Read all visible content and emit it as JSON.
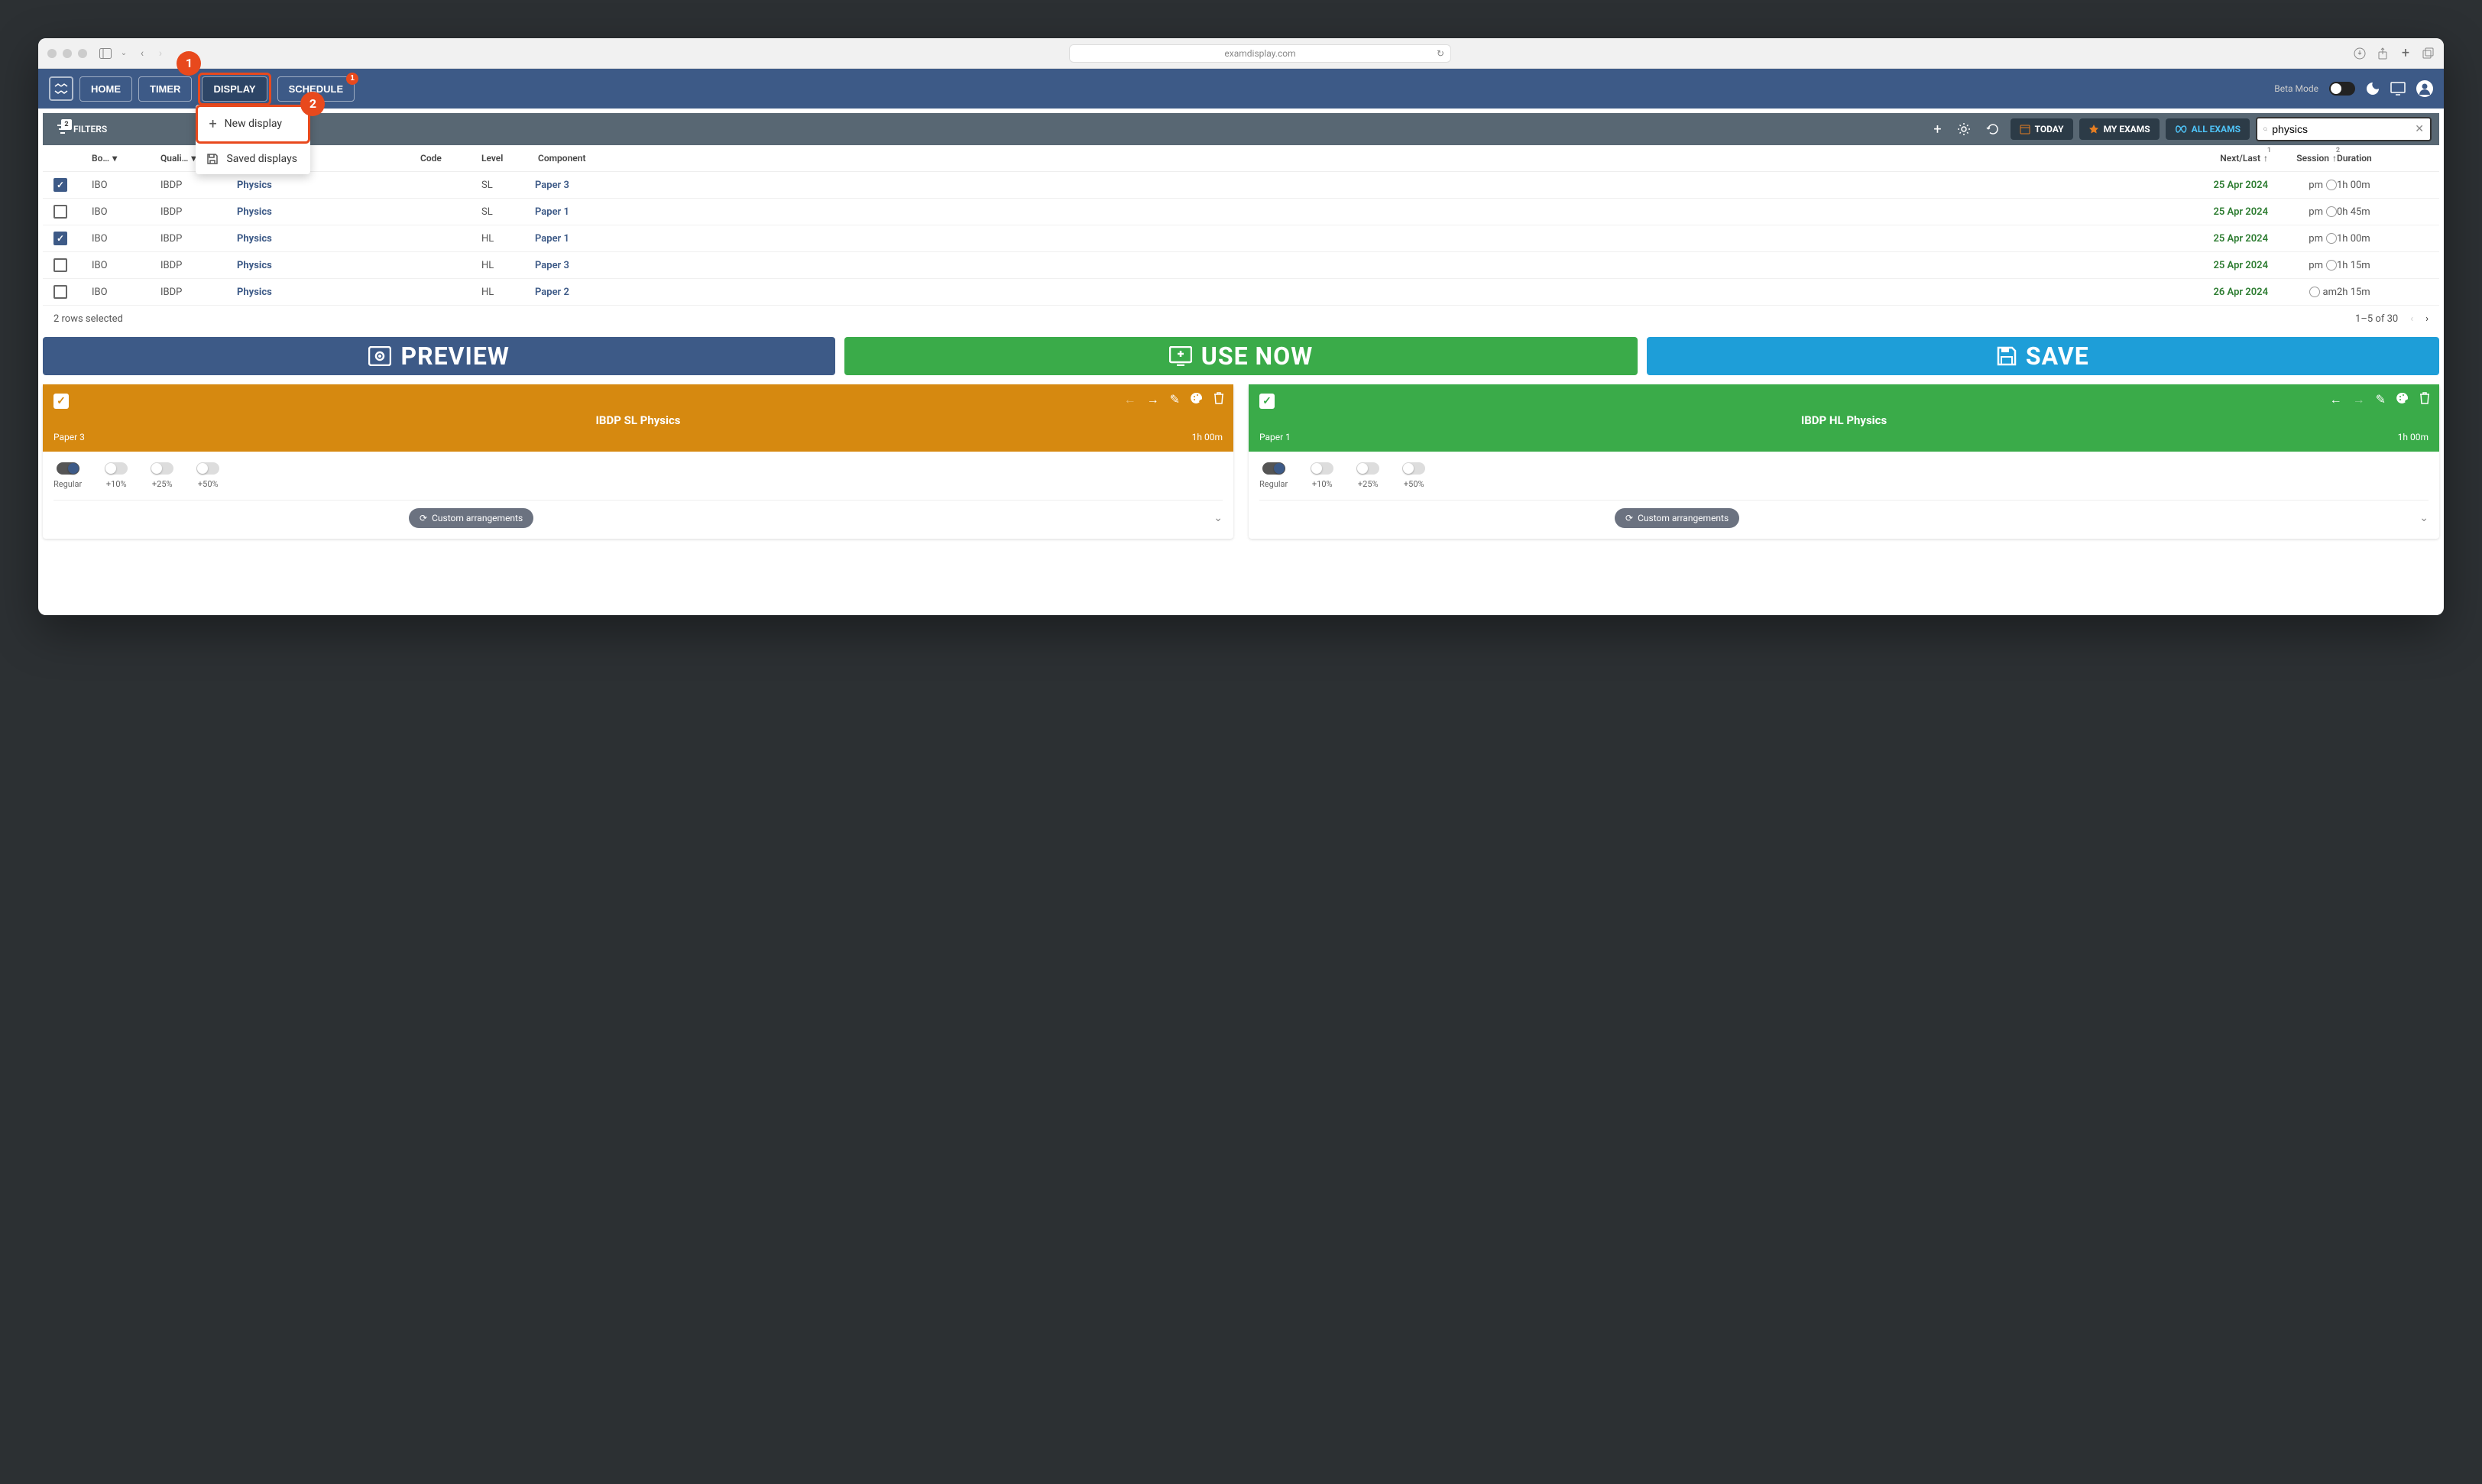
{
  "browser": {
    "url": "examdisplay.com"
  },
  "nav": {
    "home": "HOME",
    "timer": "TIMER",
    "display": "DISPLAY",
    "schedule": "SCHEDULE",
    "schedule_badge": "1"
  },
  "callouts": {
    "one": "1",
    "two": "2"
  },
  "dropdown": {
    "new": "New display",
    "saved": "Saved displays"
  },
  "header_right": {
    "beta": "Beta Mode"
  },
  "filters": {
    "label": "FILTERS",
    "badge": "2",
    "today": "TODAY",
    "myexams": "MY EXAMS",
    "allexams": "ALL EXAMS",
    "search_value": "physics"
  },
  "table": {
    "headers": {
      "board": "Bo…",
      "qualif": "Quali…",
      "code": "Code",
      "level": "Level",
      "component": "Component",
      "nextlast": "Next/Last",
      "session": "Session",
      "duration": "Duration",
      "sort_nextlast": "1",
      "sort_session": "2"
    },
    "rows": [
      {
        "checked": true,
        "board": "IBO",
        "qual": "IBDP",
        "subject": "Physics",
        "code": "",
        "level": "SL",
        "component": "Paper 3",
        "date": "25 Apr 2024",
        "sessText": "pm",
        "sessAfter": "clock",
        "duration": "1h 00m"
      },
      {
        "checked": false,
        "board": "IBO",
        "qual": "IBDP",
        "subject": "Physics",
        "code": "",
        "level": "SL",
        "component": "Paper 1",
        "date": "25 Apr 2024",
        "sessText": "pm",
        "sessAfter": "clock",
        "duration": "0h 45m"
      },
      {
        "checked": true,
        "board": "IBO",
        "qual": "IBDP",
        "subject": "Physics",
        "code": "",
        "level": "HL",
        "component": "Paper 1",
        "date": "25 Apr 2024",
        "sessText": "pm",
        "sessAfter": "clock",
        "duration": "1h 00m"
      },
      {
        "checked": false,
        "board": "IBO",
        "qual": "IBDP",
        "subject": "Physics",
        "code": "",
        "level": "HL",
        "component": "Paper 3",
        "date": "25 Apr 2024",
        "sessText": "pm",
        "sessAfter": "clock",
        "duration": "1h 15m"
      },
      {
        "checked": false,
        "board": "IBO",
        "qual": "IBDP",
        "subject": "Physics",
        "code": "",
        "level": "HL",
        "component": "Paper 2",
        "date": "26 Apr 2024",
        "sessText": "am",
        "sessAfter": "",
        "duration": "2h 15m"
      }
    ],
    "footer_left": "2 rows selected",
    "footer_right": "1–5 of 30"
  },
  "bigbtn": {
    "preview": "PREVIEW",
    "use": "USE NOW",
    "save": "SAVE"
  },
  "cards": [
    {
      "color": "orange",
      "title": "IBDP SL Physics",
      "paper": "Paper 3",
      "duration": "1h 00m",
      "arrow_dim": "left",
      "toggles": [
        {
          "label": "Regular",
          "on": true
        },
        {
          "label": "+10%",
          "on": false
        },
        {
          "label": "+25%",
          "on": false
        },
        {
          "label": "+50%",
          "on": false
        }
      ],
      "custom": "Custom arrangements"
    },
    {
      "color": "green",
      "title": "IBDP HL Physics",
      "paper": "Paper 1",
      "duration": "1h 00m",
      "arrow_dim": "right",
      "toggles": [
        {
          "label": "Regular",
          "on": true
        },
        {
          "label": "+10%",
          "on": false
        },
        {
          "label": "+25%",
          "on": false
        },
        {
          "label": "+50%",
          "on": false
        }
      ],
      "custom": "Custom arrangements"
    }
  ]
}
